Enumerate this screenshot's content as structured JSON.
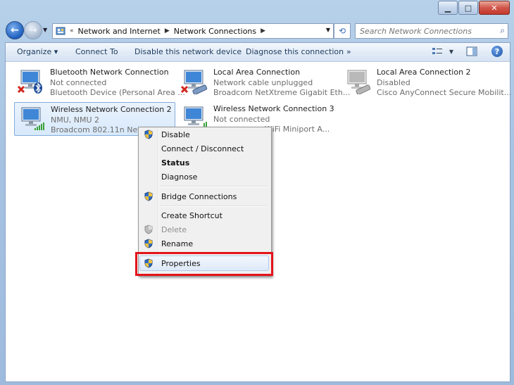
{
  "window": {
    "minimize": "▁",
    "maximize": "□",
    "close": "✕"
  },
  "nav": {
    "back_icon": "back-arrow-icon",
    "forward_icon": "forward-arrow-icon",
    "breadcrumb": [
      "Network and Internet",
      "Network Connections"
    ],
    "search_placeholder": "Search Network Connections"
  },
  "toolbar": {
    "organize": "Organize ▾",
    "connect_to": "Connect To",
    "disable_device": "Disable this network device",
    "diagnose": "Diagnose this connection",
    "more": "»"
  },
  "connections": [
    {
      "name": "Bluetooth Network Connection",
      "status": "Not connected",
      "device": "Bluetooth Device (Personal Area ...",
      "icon": "bluetooth-adapter-icon",
      "overlay": "red-x-icon"
    },
    {
      "name": "Local Area Connection",
      "status": "Network cable unplugged",
      "device": "Broadcom NetXtreme Gigabit Eth...",
      "icon": "ethernet-adapter-icon",
      "overlay": "red-x-icon"
    },
    {
      "name": "Local Area Connection 2",
      "status": "Disabled",
      "device": "Cisco AnyConnect Secure Mobilit...",
      "icon": "ethernet-adapter-disabled-icon"
    },
    {
      "name": "Wireless Network Connection 2",
      "status": "NMU, NMU  2",
      "device": "Broadcom 802.11n Network ...",
      "icon": "wireless-adapter-icon"
    },
    {
      "name": "Wireless Network Connection 3",
      "status": "Not connected",
      "device": "WiFi Miniport A...",
      "icon": "wireless-adapter-icon"
    }
  ],
  "context_menu": [
    {
      "label": "Disable",
      "shield": true
    },
    {
      "label": "Connect / Disconnect",
      "shield": false
    },
    {
      "label": "Status",
      "shield": false,
      "bold": true
    },
    {
      "label": "Diagnose",
      "shield": false
    },
    {
      "label": "Bridge Connections",
      "shield": true
    },
    {
      "label": "Create Shortcut",
      "shield": false
    },
    {
      "label": "Delete",
      "shield": true,
      "disabled": true
    },
    {
      "label": "Rename",
      "shield": true
    },
    {
      "label": "Properties",
      "shield": true,
      "highlighted": true
    }
  ],
  "colors": {
    "highlight_box": "#e4141a",
    "selection": "#84acdd"
  }
}
